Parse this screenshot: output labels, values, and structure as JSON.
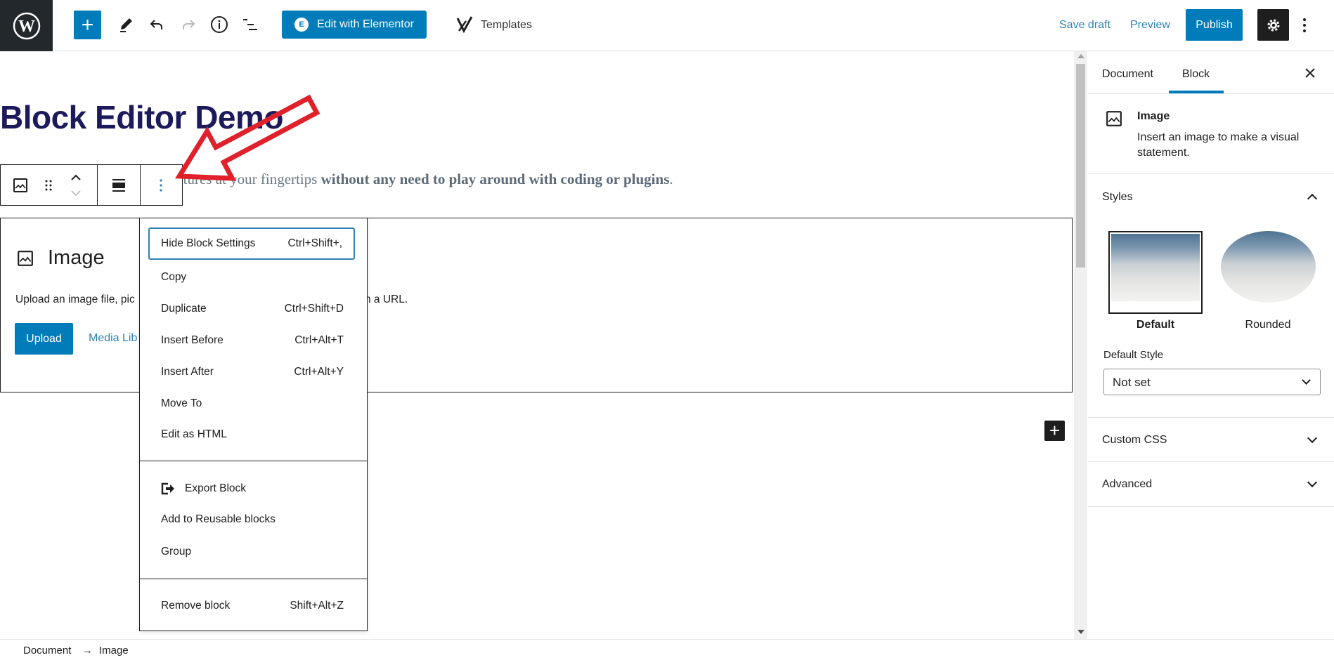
{
  "topbar": {
    "add_block": "+",
    "edit_with_elementor": "Edit with Elementor",
    "elementor_badge": "E",
    "templates": "Templates",
    "save_draft": "Save draft",
    "preview": "Preview",
    "publish": "Publish"
  },
  "editor": {
    "title": "Block Editor Demo",
    "paragraph_normal": "eatures at your fingertips ",
    "paragraph_bold": "without any need to play around with coding or plugins",
    "paragraph_end": ".",
    "image_block": {
      "label": "Image",
      "instructions_left": "Upload an image file, pic",
      "instructions_right": "h a URL.",
      "upload": "Upload",
      "media_library": "Media Lib"
    }
  },
  "block_menu": {
    "items": [
      {
        "label": "Hide Block Settings",
        "shortcut": "Ctrl+Shift+,"
      },
      {
        "label": "Copy",
        "shortcut": ""
      },
      {
        "label": "Duplicate",
        "shortcut": "Ctrl+Shift+D"
      },
      {
        "label": "Insert Before",
        "shortcut": "Ctrl+Alt+T"
      },
      {
        "label": "Insert After",
        "shortcut": "Ctrl+Alt+Y"
      },
      {
        "label": "Move To",
        "shortcut": ""
      },
      {
        "label": "Edit as HTML",
        "shortcut": ""
      }
    ],
    "export_block": "Export Block",
    "add_reusable": "Add to Reusable blocks",
    "group": "Group",
    "remove_block": "Remove block",
    "remove_shortcut": "Shift+Alt+Z"
  },
  "sidebar": {
    "tabs": [
      {
        "label": "Document"
      },
      {
        "label": "Block",
        "active": true
      }
    ],
    "block_name": "Image",
    "block_description": "Insert an image to make a visual statement.",
    "styles_title": "Styles",
    "styles": [
      {
        "label": "Default",
        "selected": true
      },
      {
        "label": "Rounded"
      }
    ],
    "default_style_label": "Default Style",
    "default_style_value": "Not set",
    "custom_css": "Custom CSS",
    "advanced": "Advanced"
  },
  "footer": {
    "breadcrumb_document": "Document",
    "breadcrumb_arrow": "→",
    "breadcrumb_image": "Image"
  },
  "colors": {
    "accent": "#007cba",
    "title": "#1d1a5c",
    "annotation_arrow": "#e0202a"
  }
}
